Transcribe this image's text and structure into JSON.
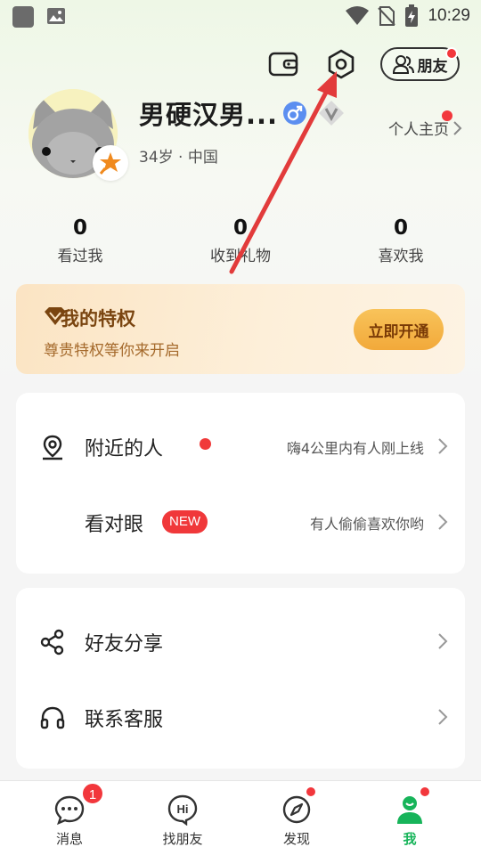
{
  "status_bar": {
    "time": "10:29"
  },
  "header": {
    "friends_label": "朋友"
  },
  "profile": {
    "nickname": "男硬汉男...",
    "age_location": "34岁 · 中国",
    "homepage_label": "个人主页"
  },
  "stats": [
    {
      "value": "0",
      "label": "看过我"
    },
    {
      "value": "0",
      "label": "收到礼物"
    },
    {
      "value": "0",
      "label": "喜欢我"
    }
  ],
  "privilege": {
    "title": "我的特权",
    "subtitle": "尊贵特权等你来开启",
    "button": "立即开通"
  },
  "menu_group_1": [
    {
      "label": "附近的人",
      "hint": "嗨4公里内有人刚上线"
    },
    {
      "label": "看对眼",
      "badge": "NEW",
      "hint": "有人偷偷喜欢你哟"
    }
  ],
  "menu_group_2": [
    {
      "label": "好友分享"
    },
    {
      "label": "联系客服"
    }
  ],
  "bottom_nav": [
    {
      "label": "消息",
      "badge": "1"
    },
    {
      "label": "找朋友"
    },
    {
      "label": "发现"
    },
    {
      "label": "我"
    }
  ],
  "colors": {
    "accent_green": "#17b45a",
    "badge_red": "#f2373c",
    "privilege_text": "#7a4510",
    "privilege_button": "#f2a93a",
    "annotation_arrow": "#e23b3b"
  },
  "icons": [
    "wallet-icon",
    "settings-icon",
    "friends-icon",
    "location-icon",
    "share-icon",
    "headset-icon",
    "message-icon",
    "hi-icon",
    "compass-icon",
    "person-icon"
  ]
}
